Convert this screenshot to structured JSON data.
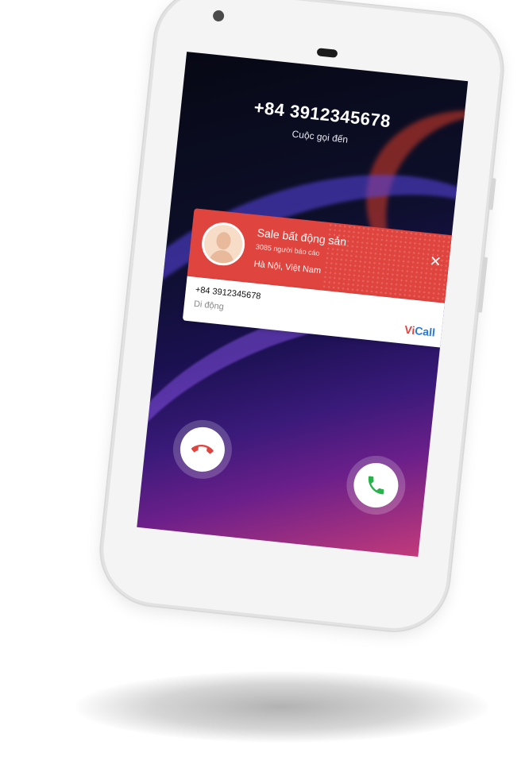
{
  "call": {
    "number": "+84 3912345678",
    "status": "Cuộc gọi đến"
  },
  "caller_card": {
    "name": "Sale bất động sản",
    "reports": "3085 người báo cáo",
    "location": "Hà Nội, Việt Nam",
    "number": "+84 3912345678",
    "type": "Di động",
    "brand_prefix": "Vi",
    "brand_suffix": "Call"
  },
  "icons": {
    "close": "close-icon",
    "decline": "phone-hangup-icon",
    "accept": "phone-answer-icon"
  },
  "colors": {
    "card_red": "#e0443e",
    "decline_red": "#e0443e",
    "accept_green": "#27b24a",
    "brand_blue": "#2a7ad4"
  }
}
